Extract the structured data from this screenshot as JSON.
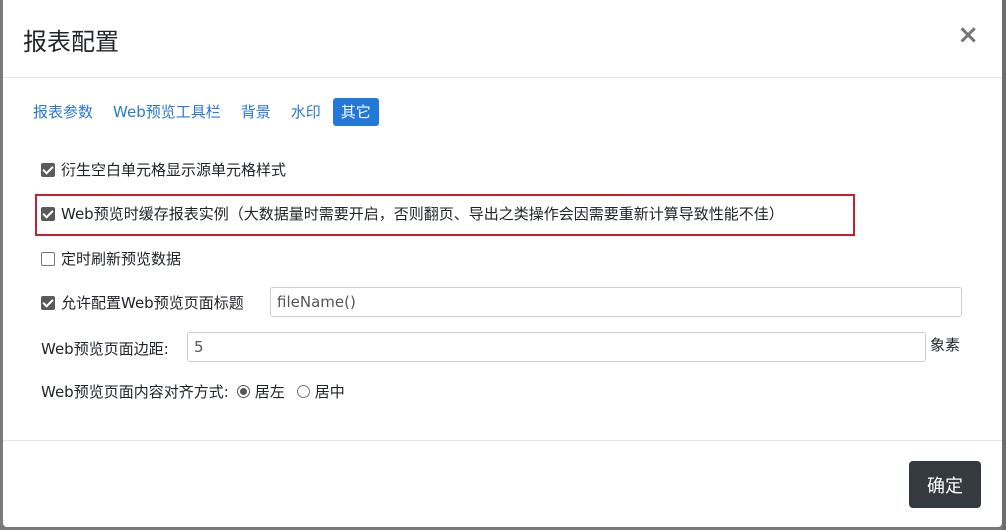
{
  "dialog": {
    "title": "报表配置",
    "close": "×"
  },
  "tabs": [
    {
      "label": "报表参数",
      "active": false
    },
    {
      "label": "Web预览工具栏",
      "active": false
    },
    {
      "label": "背景",
      "active": false
    },
    {
      "label": "水印",
      "active": false
    },
    {
      "label": "其它",
      "active": true
    }
  ],
  "options": {
    "derived_blank_cells": {
      "label": "衍生空白单元格显示源单元格样式",
      "checked": true
    },
    "cache_instance": {
      "label": "Web预览时缓存报表实例（大数据量时需要开启，否则翻页、导出之类操作会因需要重新计算导致性能不佳）",
      "checked": true
    },
    "auto_refresh": {
      "label": "定时刷新预览数据",
      "checked": false
    },
    "allow_title": {
      "label": "允许配置Web预览页面标题",
      "checked": true,
      "value": "fileName()"
    }
  },
  "margin": {
    "label": "Web预览页面边距:",
    "value": "5",
    "unit": "象素"
  },
  "align": {
    "label": "Web预览页面内容对齐方式:",
    "options": [
      {
        "label": "居左",
        "checked": true
      },
      {
        "label": "居中",
        "checked": false
      }
    ]
  },
  "footer": {
    "ok_label": "确定"
  }
}
